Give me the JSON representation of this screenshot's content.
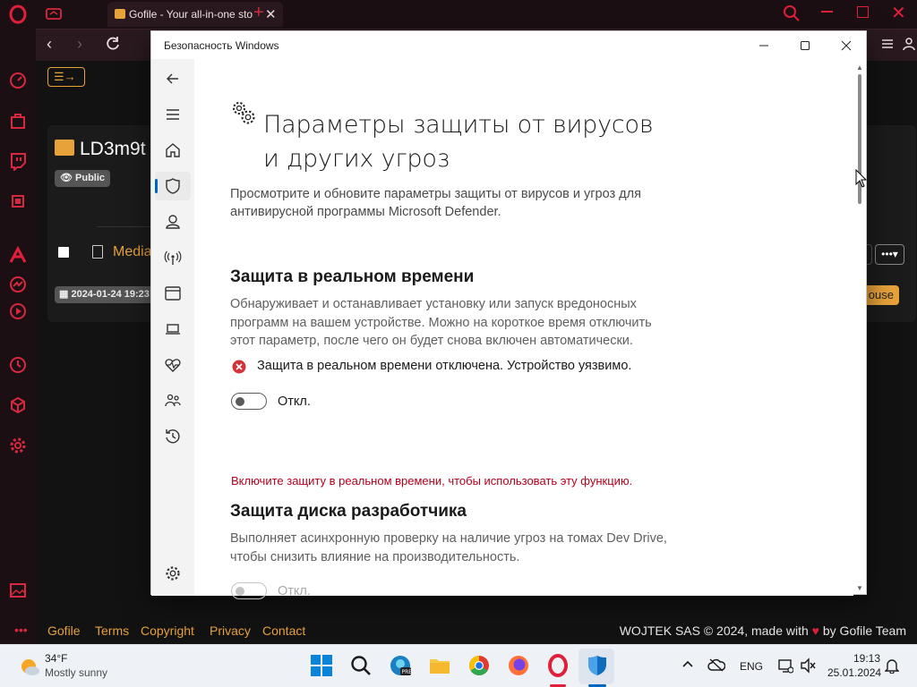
{
  "browser": {
    "tab_title": "Gofile - Your all-in-one sto",
    "page": {
      "folder_name": "LD3m9t",
      "public_badge": "Public",
      "file_name": "Media",
      "date_badge": "2024-01-24 19:23",
      "partial_button": "ouse"
    },
    "footer": {
      "links": [
        "Gofile",
        "Terms",
        "Copyright",
        "Privacy",
        "Contact"
      ],
      "right_text": "WOJTEK SAS © 2024, made with",
      "right_text_tail": "by Gofile Team"
    }
  },
  "dialog": {
    "window_title": "Безопасность Windows",
    "page_title": "Параметры защиты от вирусов и других угроз",
    "page_description": "Просмотрите и обновите параметры защиты от вирусов и угроз для антивирусной программы Microsoft Defender.",
    "realtime": {
      "heading": "Защита в реальном времени",
      "description": "Обнаруживает и останавливает установку или запуск вредоносных программ на вашем устройстве. Можно на короткое время отключить этот параметр, после чего он будет снова включен автоматически.",
      "status": "Защита в реальном времени отключена. Устройство уязвимо.",
      "toggle_label": "Откл.",
      "toggle_on": false
    },
    "devdrive": {
      "warning": "Включите защиту в реальном времени, чтобы использовать эту функцию.",
      "heading": "Защита диска разработчика",
      "description": "Выполняет асинхронную проверку на наличие угроз на томах Dev Drive, чтобы снизить влияние на производительность.",
      "toggle_label": "Откл.",
      "toggle_on": false,
      "toggle_disabled": true
    }
  },
  "taskbar": {
    "weather_temp": "34°F",
    "weather_desc": "Mostly sunny",
    "language": "ENG",
    "time": "19:13",
    "date": "25.01.2024"
  },
  "colors": {
    "opera_accent": "#e0203a",
    "gofile_orange": "#e7a23a",
    "warning_red": "#b3001b",
    "status_red": "#d13438",
    "accent_blue": "#0067c0"
  }
}
